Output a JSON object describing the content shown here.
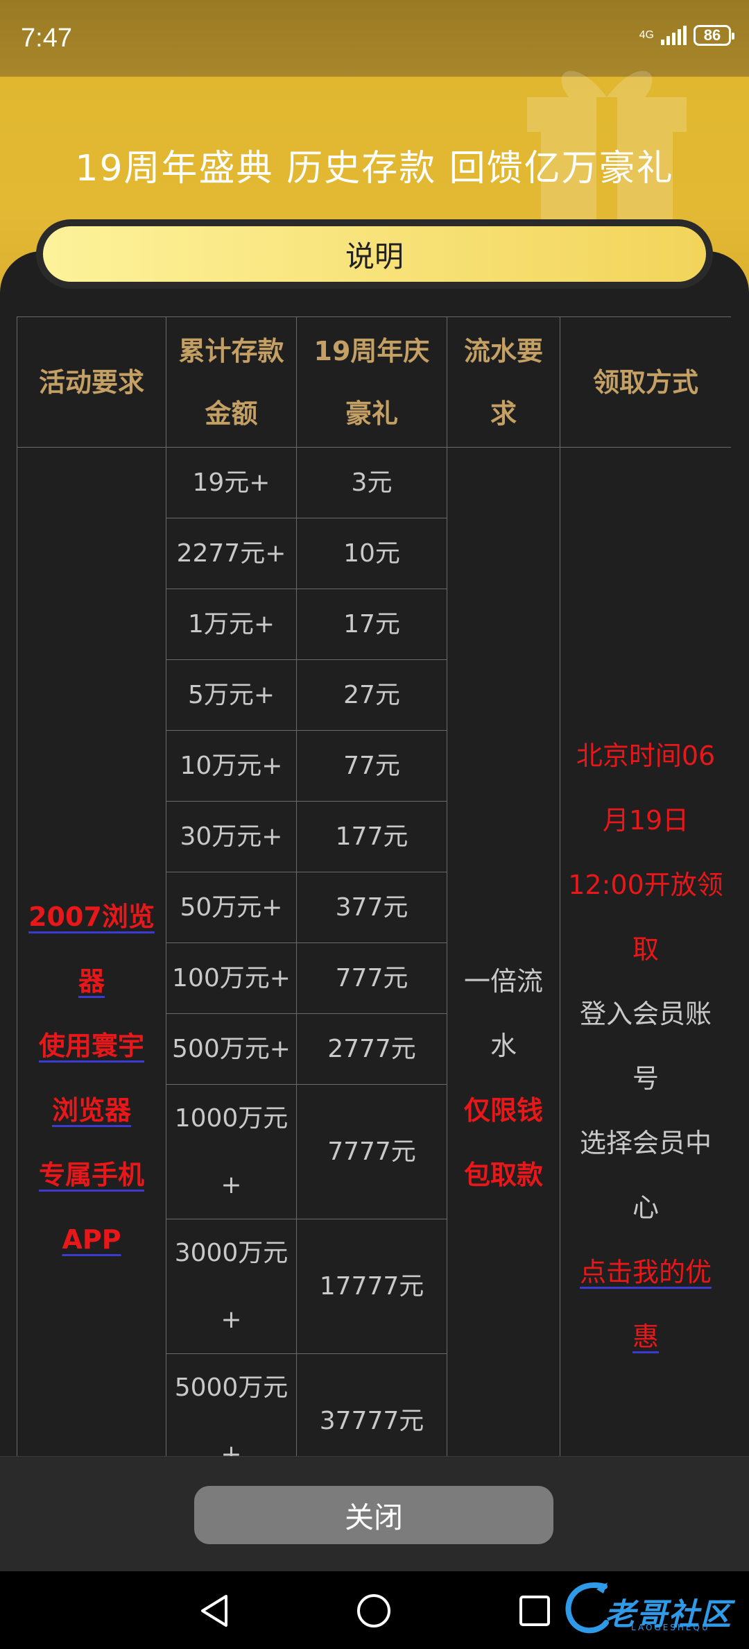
{
  "status_bar": {
    "time": "7:47",
    "network": "4G",
    "battery": "86"
  },
  "title": "19周年盛典  历史存款 回馈亿万豪礼",
  "explain_button": "说明",
  "table": {
    "headers": {
      "col1": "活动要求",
      "col2_line1": "累计存款",
      "col2_line2": "金额",
      "col3_line1": "19周年庆",
      "col3_line2": "豪礼",
      "col4_line1": "流水要",
      "col4_line2": "求",
      "col5": "领取方式"
    },
    "requirement": [
      "2007浏览",
      "器",
      "使用寰宇",
      "浏览器",
      "专属手机",
      "APP"
    ],
    "rows": [
      {
        "amount": "19元+",
        "gift": "3元"
      },
      {
        "amount": "2277元+",
        "gift": "10元"
      },
      {
        "amount": "1万元+",
        "gift": "17元"
      },
      {
        "amount": "5万元+",
        "gift": "27元"
      },
      {
        "amount": "10万元+",
        "gift": "77元"
      },
      {
        "amount": "30万元+",
        "gift": "177元"
      },
      {
        "amount": "50万元+",
        "gift": "377元"
      },
      {
        "amount": "100万元+",
        "gift": "777元"
      },
      {
        "amount": "500万元+",
        "gift": "2777元"
      },
      {
        "amount": "1000万元",
        "amount_suffix": "+",
        "gift": "7777元"
      },
      {
        "amount": "3000万元",
        "amount_suffix": "+",
        "gift": "17777元"
      },
      {
        "amount": "5000万元",
        "amount_suffix": "+",
        "gift": "37777元"
      }
    ],
    "turnover": {
      "line1": "一倍流",
      "line2": "水",
      "line3": "仅限钱",
      "line4": "包取款"
    },
    "claim": {
      "red_line1": "北京时间06",
      "red_line2": "月19日",
      "red_line3": "12:00开放领",
      "red_line4": "取",
      "line5": "登入会员账",
      "line6": "号",
      "line7": "选择会员中",
      "line8": "心",
      "link_line1": "点击我的优",
      "link_line2": "惠"
    }
  },
  "close_button": "关闭",
  "watermark": {
    "text": "老哥社区",
    "sub": "LAOGESHEQU"
  },
  "colors": {
    "header_gold": "#e3b934",
    "accent_red": "#e8171a",
    "header_text": "#c4a064"
  }
}
